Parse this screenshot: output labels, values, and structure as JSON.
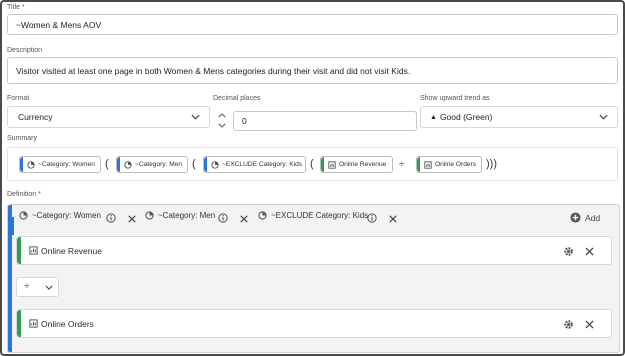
{
  "title_field": {
    "label": "Title",
    "required_mark": "*",
    "value": "~Women & Mens AOV"
  },
  "description_field": {
    "label": "Description",
    "value": "Visitor visited at least one page in both Women & Mens categories during their visit and did not visit Kids."
  },
  "format_field": {
    "label": "Format",
    "value": "Currency"
  },
  "decimal_field": {
    "label": "Decimal places",
    "value": "0"
  },
  "trend_field": {
    "label": "Show upward trend as",
    "value": "Good (Green)",
    "marker": "▲"
  },
  "summary": {
    "label": "Summary",
    "parens": {
      "open": "(",
      "close": ")",
      "close_triple": ")))",
      "divide": "÷"
    },
    "pills": [
      {
        "label": "~Category: Women",
        "kind": "segment"
      },
      {
        "label": "~Category: Men",
        "kind": "segment"
      },
      {
        "label": "~EXCLUDE Category: Kids",
        "kind": "segment"
      },
      {
        "label": "Online Revenue",
        "kind": "metric"
      },
      {
        "label": "Online Orders",
        "kind": "metric"
      }
    ]
  },
  "definition": {
    "label": "Definition",
    "required_mark": "*",
    "conditions": [
      {
        "label": "~Category: Women"
      },
      {
        "label": "~Category: Men"
      },
      {
        "label": "~EXCLUDE Category: Kids"
      }
    ],
    "add_label": "Add",
    "operator": "÷",
    "metrics": [
      {
        "label": "Online Revenue"
      },
      {
        "label": "Online Orders"
      }
    ]
  },
  "colors": {
    "segment_blue": "#2f74d8",
    "metric_green": "#2e9e4f"
  }
}
